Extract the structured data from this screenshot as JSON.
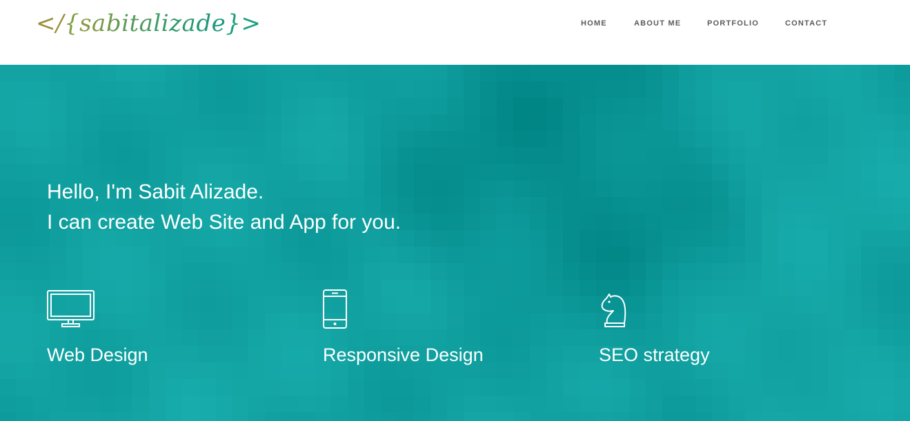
{
  "logo": {
    "lt": "</",
    "brace_open": "{",
    "name": "sabitalizade",
    "brace_close": "}",
    "gt": ">"
  },
  "nav": {
    "items": [
      "HOME",
      "ABOUT ME",
      "PORTFOLIO",
      "CONTACT"
    ]
  },
  "hero": {
    "line1": "Hello, I'm Sabit Alizade.",
    "line2": "I can create Web Site and App for you.",
    "background_color": "#11a0a0"
  },
  "features": [
    {
      "icon": "monitor-icon",
      "label": "Web Design"
    },
    {
      "icon": "smartphone-icon",
      "label": "Responsive Design"
    },
    {
      "icon": "chess-knight-icon",
      "label": "SEO strategy"
    }
  ]
}
